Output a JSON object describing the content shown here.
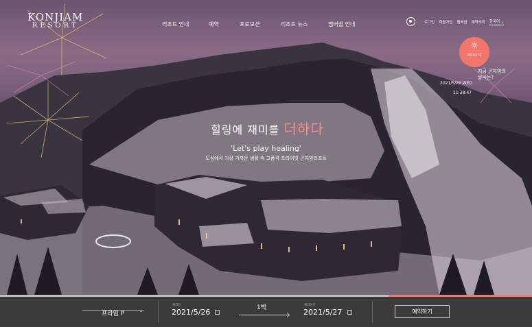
{
  "brand": {
    "line1": "KONJIAM",
    "line2": "RESORT"
  },
  "nav": [
    "리조트 안내",
    "예약",
    "프로모션",
    "리조트 뉴스",
    "멤버쉽 안내"
  ],
  "util": {
    "items": [
      "로그인",
      "회원가입",
      "멤버쉽",
      "예약조회"
    ],
    "language": "한국어"
  },
  "weather": {
    "temp": "20.01°C",
    "question": [
      "지금 곤지암의",
      "날씨는?"
    ],
    "date": "2021/5/26 WED",
    "time": "11:38:47"
  },
  "hero": {
    "kr_plain": "힐링에 재미를 ",
    "kr_accent": "더하다",
    "en": "'Let's play healing'",
    "sub": "도심에서 가장 가까운 생활 속 고품격 프라이빗 곤지암리조트"
  },
  "booking": {
    "room": "프라임 P",
    "checkin_label": "체크인",
    "checkin": "2021/5/26",
    "nights": "1박",
    "checkout_label": "체크아웃",
    "checkout": "2021/5/27",
    "submit": "예약하기",
    "slide_progress": 0.27
  },
  "colors": {
    "accent": "#f3766c",
    "bar": "#3b3b3b"
  }
}
